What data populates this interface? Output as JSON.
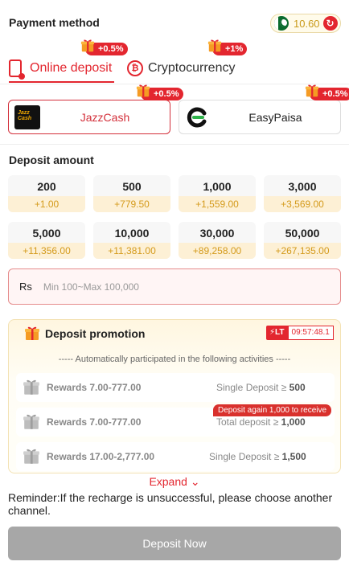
{
  "header": {
    "title": "Payment method",
    "balance": "10.60"
  },
  "tabs": [
    {
      "label": "Online deposit",
      "badge": "+0.5%"
    },
    {
      "label": "Cryptocurrency",
      "badge": "+1%"
    }
  ],
  "channels": [
    {
      "name": "JazzCash",
      "badge": "+0.5%",
      "logo_text": "JazzCash",
      "logo_subtext": "Business"
    },
    {
      "name": "EasyPaisa",
      "badge": "+0.5%"
    }
  ],
  "deposit_amount": {
    "title": "Deposit amount",
    "options": [
      {
        "amount": "200",
        "bonus": "+1.00"
      },
      {
        "amount": "500",
        "bonus": "+779.50"
      },
      {
        "amount": "1,000",
        "bonus": "+1,559.00"
      },
      {
        "amount": "3,000",
        "bonus": "+3,569.00"
      },
      {
        "amount": "5,000",
        "bonus": "+11,356.00"
      },
      {
        "amount": "10,000",
        "bonus": "+11,381.00"
      },
      {
        "amount": "30,000",
        "bonus": "+89,258.00"
      },
      {
        "amount": "50,000",
        "bonus": "+267,135.00"
      }
    ],
    "currency": "Rs",
    "placeholder": "Min 100~Max 100,000"
  },
  "promotion": {
    "title": "Deposit promotion",
    "timer_icon": "LT",
    "timer": "09:57:48.1",
    "auto_text": "----- Automatically participated in the following activities -----",
    "rewards": [
      {
        "label": "Rewards 7.00-777.00",
        "condition": "Single Deposit ≥ ",
        "value": "500"
      },
      {
        "label": "Rewards 7.00-777.00",
        "condition": "Total deposit ≥ ",
        "value": "1,000",
        "tag": "Deposit again 1,000 to receive"
      },
      {
        "label": "Rewards 17.00-2,777.00",
        "condition": "Single Deposit ≥ ",
        "value": "1,500"
      }
    ],
    "expand_label": "Expand"
  },
  "reminder": "Reminder:If the recharge is unsuccessful, please choose another channel.",
  "deposit_button": "Deposit Now",
  "colors": {
    "accent": "#e3262f",
    "bonus": "#d49a1b",
    "button_disabled": "#a7a7a7"
  }
}
